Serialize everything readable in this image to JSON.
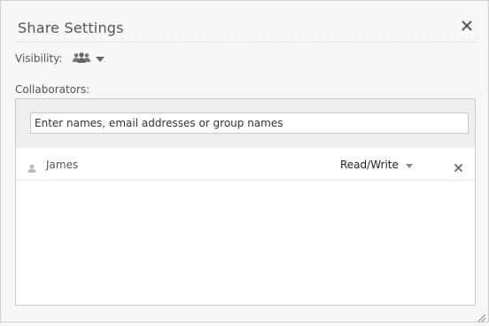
{
  "dialog": {
    "title": "Share Settings",
    "close_icon": "close-icon"
  },
  "visibility": {
    "label": "Visibility:",
    "icon": "group-icon",
    "dropdown_icon": "caret-down-icon"
  },
  "collaborators": {
    "label": "Collaborators:",
    "search": {
      "placeholder": "Enter names, email addresses or group names",
      "value": ""
    },
    "items": [
      {
        "icon": "person-icon",
        "name": "James",
        "permission": "Read/Write",
        "remove_icon": "remove-icon"
      }
    ]
  },
  "colors": {
    "background": "#f7f7f7",
    "panel": "#ffffff",
    "search_area": "#efefef",
    "border": "#c9c9c9",
    "icon": "#777777"
  }
}
